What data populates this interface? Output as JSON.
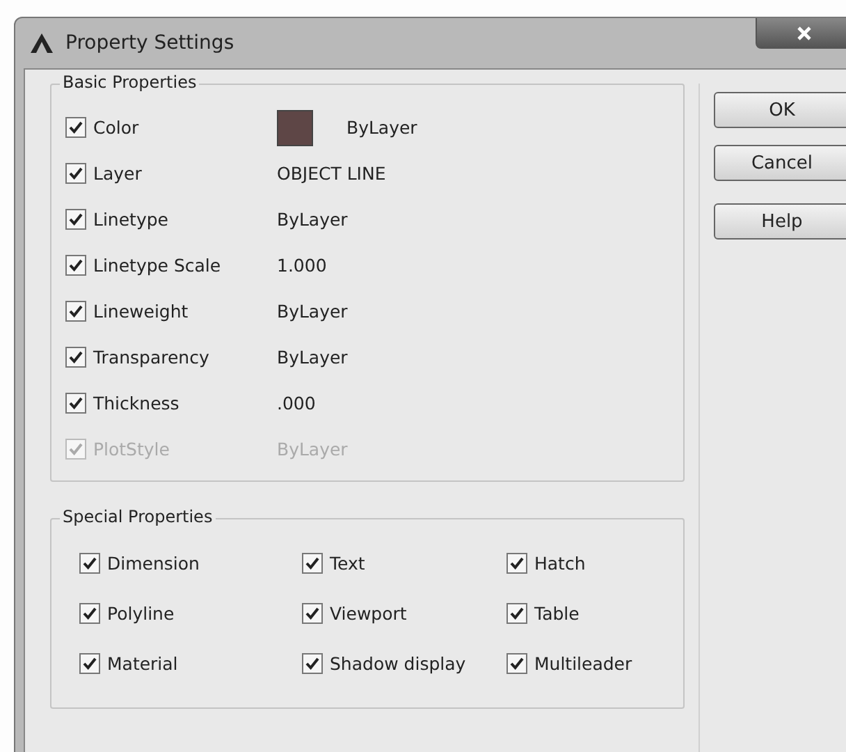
{
  "window": {
    "title": "Property Settings"
  },
  "basic_properties": {
    "title": "Basic Properties",
    "rows": [
      {
        "label": "Color",
        "value": "ByLayer",
        "checked": true,
        "disabled": false,
        "kind": "swatch"
      },
      {
        "label": "Layer",
        "value": "OBJECT LINE",
        "checked": true,
        "disabled": false,
        "kind": "text"
      },
      {
        "label": "Linetype",
        "value": "ByLayer",
        "checked": true,
        "disabled": false,
        "kind": "text"
      },
      {
        "label": "Linetype Scale",
        "value": "1.000",
        "checked": true,
        "disabled": false,
        "kind": "text"
      },
      {
        "label": "Lineweight",
        "value": "ByLayer",
        "checked": true,
        "disabled": false,
        "kind": "text"
      },
      {
        "label": "Transparency",
        "value": "ByLayer",
        "checked": true,
        "disabled": false,
        "kind": "text"
      },
      {
        "label": "Thickness",
        "value": ".000",
        "checked": true,
        "disabled": false,
        "kind": "text"
      },
      {
        "label": "PlotStyle",
        "value": "ByLayer",
        "checked": true,
        "disabled": true,
        "kind": "text"
      }
    ]
  },
  "special_properties": {
    "title": "Special Properties",
    "items": [
      {
        "label": "Dimension",
        "checked": true
      },
      {
        "label": "Text",
        "checked": true
      },
      {
        "label": "Hatch",
        "checked": true
      },
      {
        "label": "Polyline",
        "checked": true
      },
      {
        "label": "Viewport",
        "checked": true
      },
      {
        "label": "Table",
        "checked": true
      },
      {
        "label": "Material",
        "checked": true
      },
      {
        "label": "Shadow display",
        "checked": true
      },
      {
        "label": "Multileader",
        "checked": true
      }
    ]
  },
  "buttons": [
    "OK",
    "Cancel",
    "Help"
  ]
}
